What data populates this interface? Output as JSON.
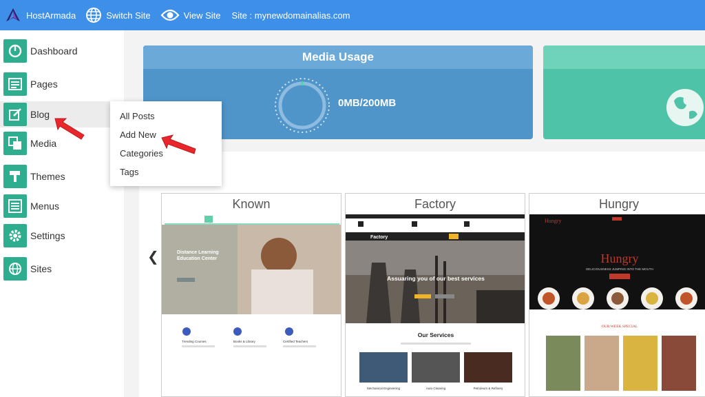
{
  "topbar": {
    "brand": "HostArmada",
    "switch_site": "Switch Site",
    "view_site": "View Site",
    "site_label": "Site : mynewdomainalias.com"
  },
  "sidebar": {
    "items": [
      {
        "label": "Dashboard",
        "icon": "dashboard-icon"
      },
      {
        "label": "Pages",
        "icon": "pages-icon"
      },
      {
        "label": "Blog",
        "icon": "blog-icon"
      },
      {
        "label": "Media",
        "icon": "media-icon"
      },
      {
        "label": "Themes",
        "icon": "themes-icon"
      },
      {
        "label": "Menus",
        "icon": "menus-icon"
      },
      {
        "label": "Settings",
        "icon": "settings-icon"
      },
      {
        "label": "Sites",
        "icon": "sites-icon"
      }
    ]
  },
  "blog_menu": {
    "items": [
      "All Posts",
      "Add New",
      "Categories",
      "Tags"
    ]
  },
  "media_usage": {
    "title": "Media Usage",
    "value": "0MB/200MB"
  },
  "themes": [
    {
      "name": "Known"
    },
    {
      "name": "Factory"
    },
    {
      "name": "Hungry"
    }
  ],
  "theme_previews": {
    "known": {
      "hero_line1": "Distance Learning",
      "hero_line2": "Education Center",
      "features": [
        "Trending Courses",
        "Books & Library",
        "Certified Teachers"
      ]
    },
    "factory": {
      "logo": "Factory",
      "hero": "Assuaring you of our best services",
      "section": "Our Services",
      "services": [
        "Mechanical Engineering",
        "Auto Cleaning",
        "Petroleum & Refinery"
      ]
    },
    "hungry": {
      "logo": "Hungry",
      "hero": "Hungry",
      "tagline": "DELICIOUSNESS JUMPING INTO THE MOUTH",
      "special": "OUR WEEK SPECIAL"
    }
  },
  "colors": {
    "topbar": "#3d8fe8",
    "nav_icon": "#2fae8f",
    "media_card": "#4f95c9",
    "green_card": "#4fc3a7",
    "annotation_arrow": "#e8262b"
  }
}
